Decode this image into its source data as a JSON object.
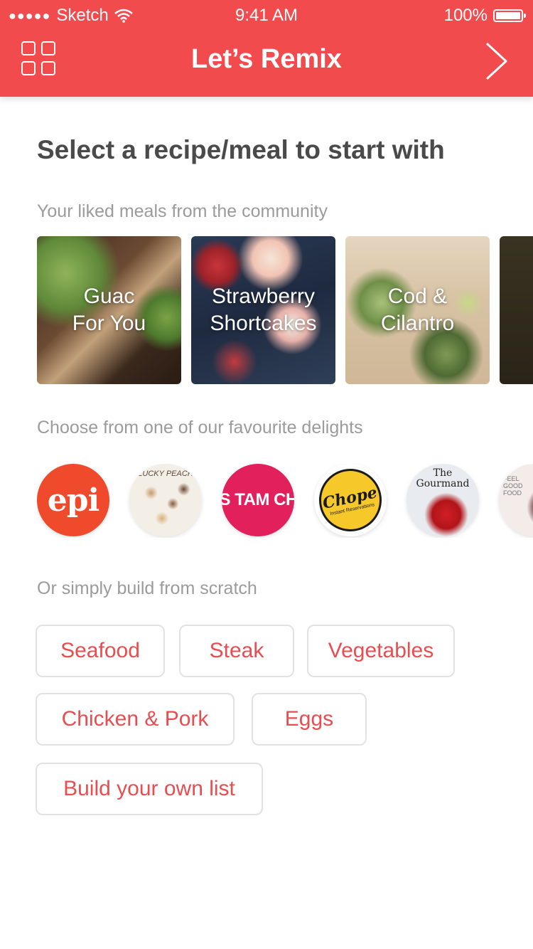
{
  "status_bar": {
    "carrier": "Sketch",
    "time": "9:41 AM",
    "battery": "100%"
  },
  "nav": {
    "title": "Let’s Remix"
  },
  "heading": "Select a recipe/meal to start with",
  "liked_section": {
    "label": "Your liked meals from the community",
    "meals": [
      {
        "line1": "Guac",
        "line2": "For You"
      },
      {
        "line1": "Strawberry",
        "line2": "Shortcakes"
      },
      {
        "line1": "Cod &",
        "line2": "Cilantro"
      },
      {
        "line1": "",
        "line2": ""
      }
    ]
  },
  "favourites_section": {
    "label": "Choose from one of our favourite delights",
    "sources": [
      {
        "text": "epi"
      },
      {
        "text": "LUCKY PEACH"
      },
      {
        "text": "MISS TAM CHIAK"
      },
      {
        "text": "Chope",
        "subtext": "Instant Reservations"
      },
      {
        "text": "The Gourmand"
      },
      {
        "text": "FEEL GOOD FOOD"
      }
    ]
  },
  "scratch_section": {
    "label": "Or simply build from scratch",
    "chips": [
      "Seafood",
      "Steak",
      "Vegetables",
      "Chicken & Pork",
      "Eggs",
      "Build your own list"
    ]
  },
  "colors": {
    "accent": "#f24b4e",
    "chip_text": "#e84d50"
  }
}
